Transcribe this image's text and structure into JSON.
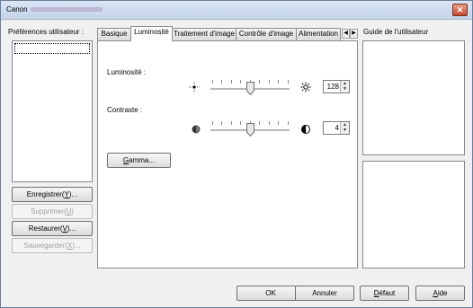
{
  "window": {
    "title": "Canon",
    "close_icon": "close-icon"
  },
  "left": {
    "prefs_label": "Préférences utilisateur :",
    "buttons": {
      "save": "Enregistrer(Y)...",
      "delete": "Supprimer(U)",
      "restore": "Restaurer(V)...",
      "backup": "Sauvegarder(X)..."
    }
  },
  "tabs": [
    "Basique",
    "Luminosité",
    "Traitement d'image",
    "Contrôle d'image",
    "Alimentation"
  ],
  "active_tab": "Luminosité",
  "brightness": {
    "label": "Luminosité :",
    "value": "128",
    "level": 0.5,
    "icon_low": "dim-sun-icon",
    "icon_high": "bright-sun-icon"
  },
  "contrast": {
    "label": "Contraste :",
    "value": "4",
    "level": 0.5,
    "icon_low": "low-contrast-icon",
    "icon_high": "high-contrast-icon"
  },
  "gamma_button": "Gamma...",
  "guide": {
    "label": "Guide de l'utilisateur"
  },
  "footer": {
    "ok": "OK",
    "cancel": "Annuler",
    "default": "Défaut",
    "help": "Aide"
  }
}
